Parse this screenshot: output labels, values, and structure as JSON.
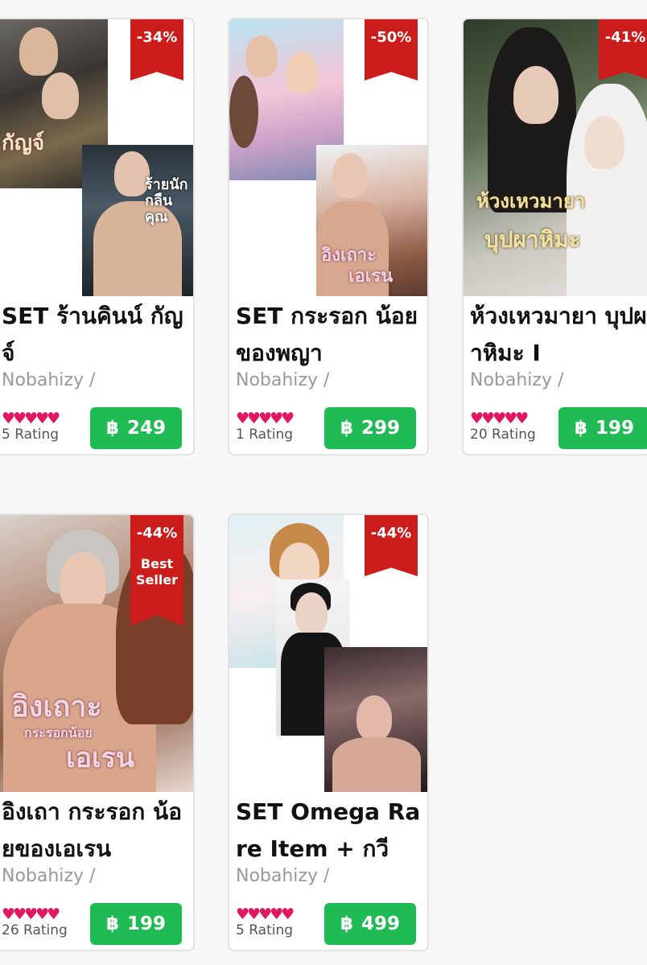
{
  "currency_symbol": "฿",
  "products": [
    {
      "title": "SET ร้านคินน์ กัญจ์",
      "author": "Nobahizy /",
      "rating_stars": 5,
      "rating_text": "5 Rating",
      "price": "249",
      "discount": "-34%",
      "best_seller": "",
      "cover_text": [
        "ร้ายนักกลืนคุณ"
      ]
    },
    {
      "title": "SET กระรอก น้อยของพญา",
      "author": "Nobahizy /",
      "rating_stars": 5,
      "rating_text": "1 Rating",
      "price": "299",
      "discount": "-50%",
      "best_seller": "",
      "cover_text": [
        "อิงเถาะ",
        "เอเรน"
      ]
    },
    {
      "title": "ห้วงเหวมายา บุปผาหิมะ I",
      "author": "Nobahizy /",
      "rating_stars": 5,
      "rating_text": "20 Rating",
      "price": "199",
      "discount": "-41%",
      "best_seller": "",
      "cover_text": [
        "ห้วงเหวมายา",
        "บุปผาหิมะ"
      ]
    },
    {
      "title": "อิงเถา กระรอก น้อยของเอเรน",
      "author": "Nobahizy /",
      "rating_stars": 5,
      "rating_text": "26 Rating",
      "price": "199",
      "discount": "-44%",
      "best_seller": "Best Seller",
      "cover_text": [
        "อิงเถาะ",
        "กระรอกน้อย",
        "เอเรน"
      ]
    },
    {
      "title": "SET Omega Rare Item + กวี",
      "author": "Nobahizy /",
      "rating_stars": 5,
      "rating_text": "5 Rating",
      "price": "499",
      "discount": "-44%",
      "best_seller": "",
      "cover_text": []
    }
  ],
  "colors": {
    "discount": "#cc1d1d",
    "price_button": "#20bb55",
    "hearts": "#e0185f"
  },
  "icons": {
    "rating": "heart-icon",
    "currency": "baht-icon"
  }
}
